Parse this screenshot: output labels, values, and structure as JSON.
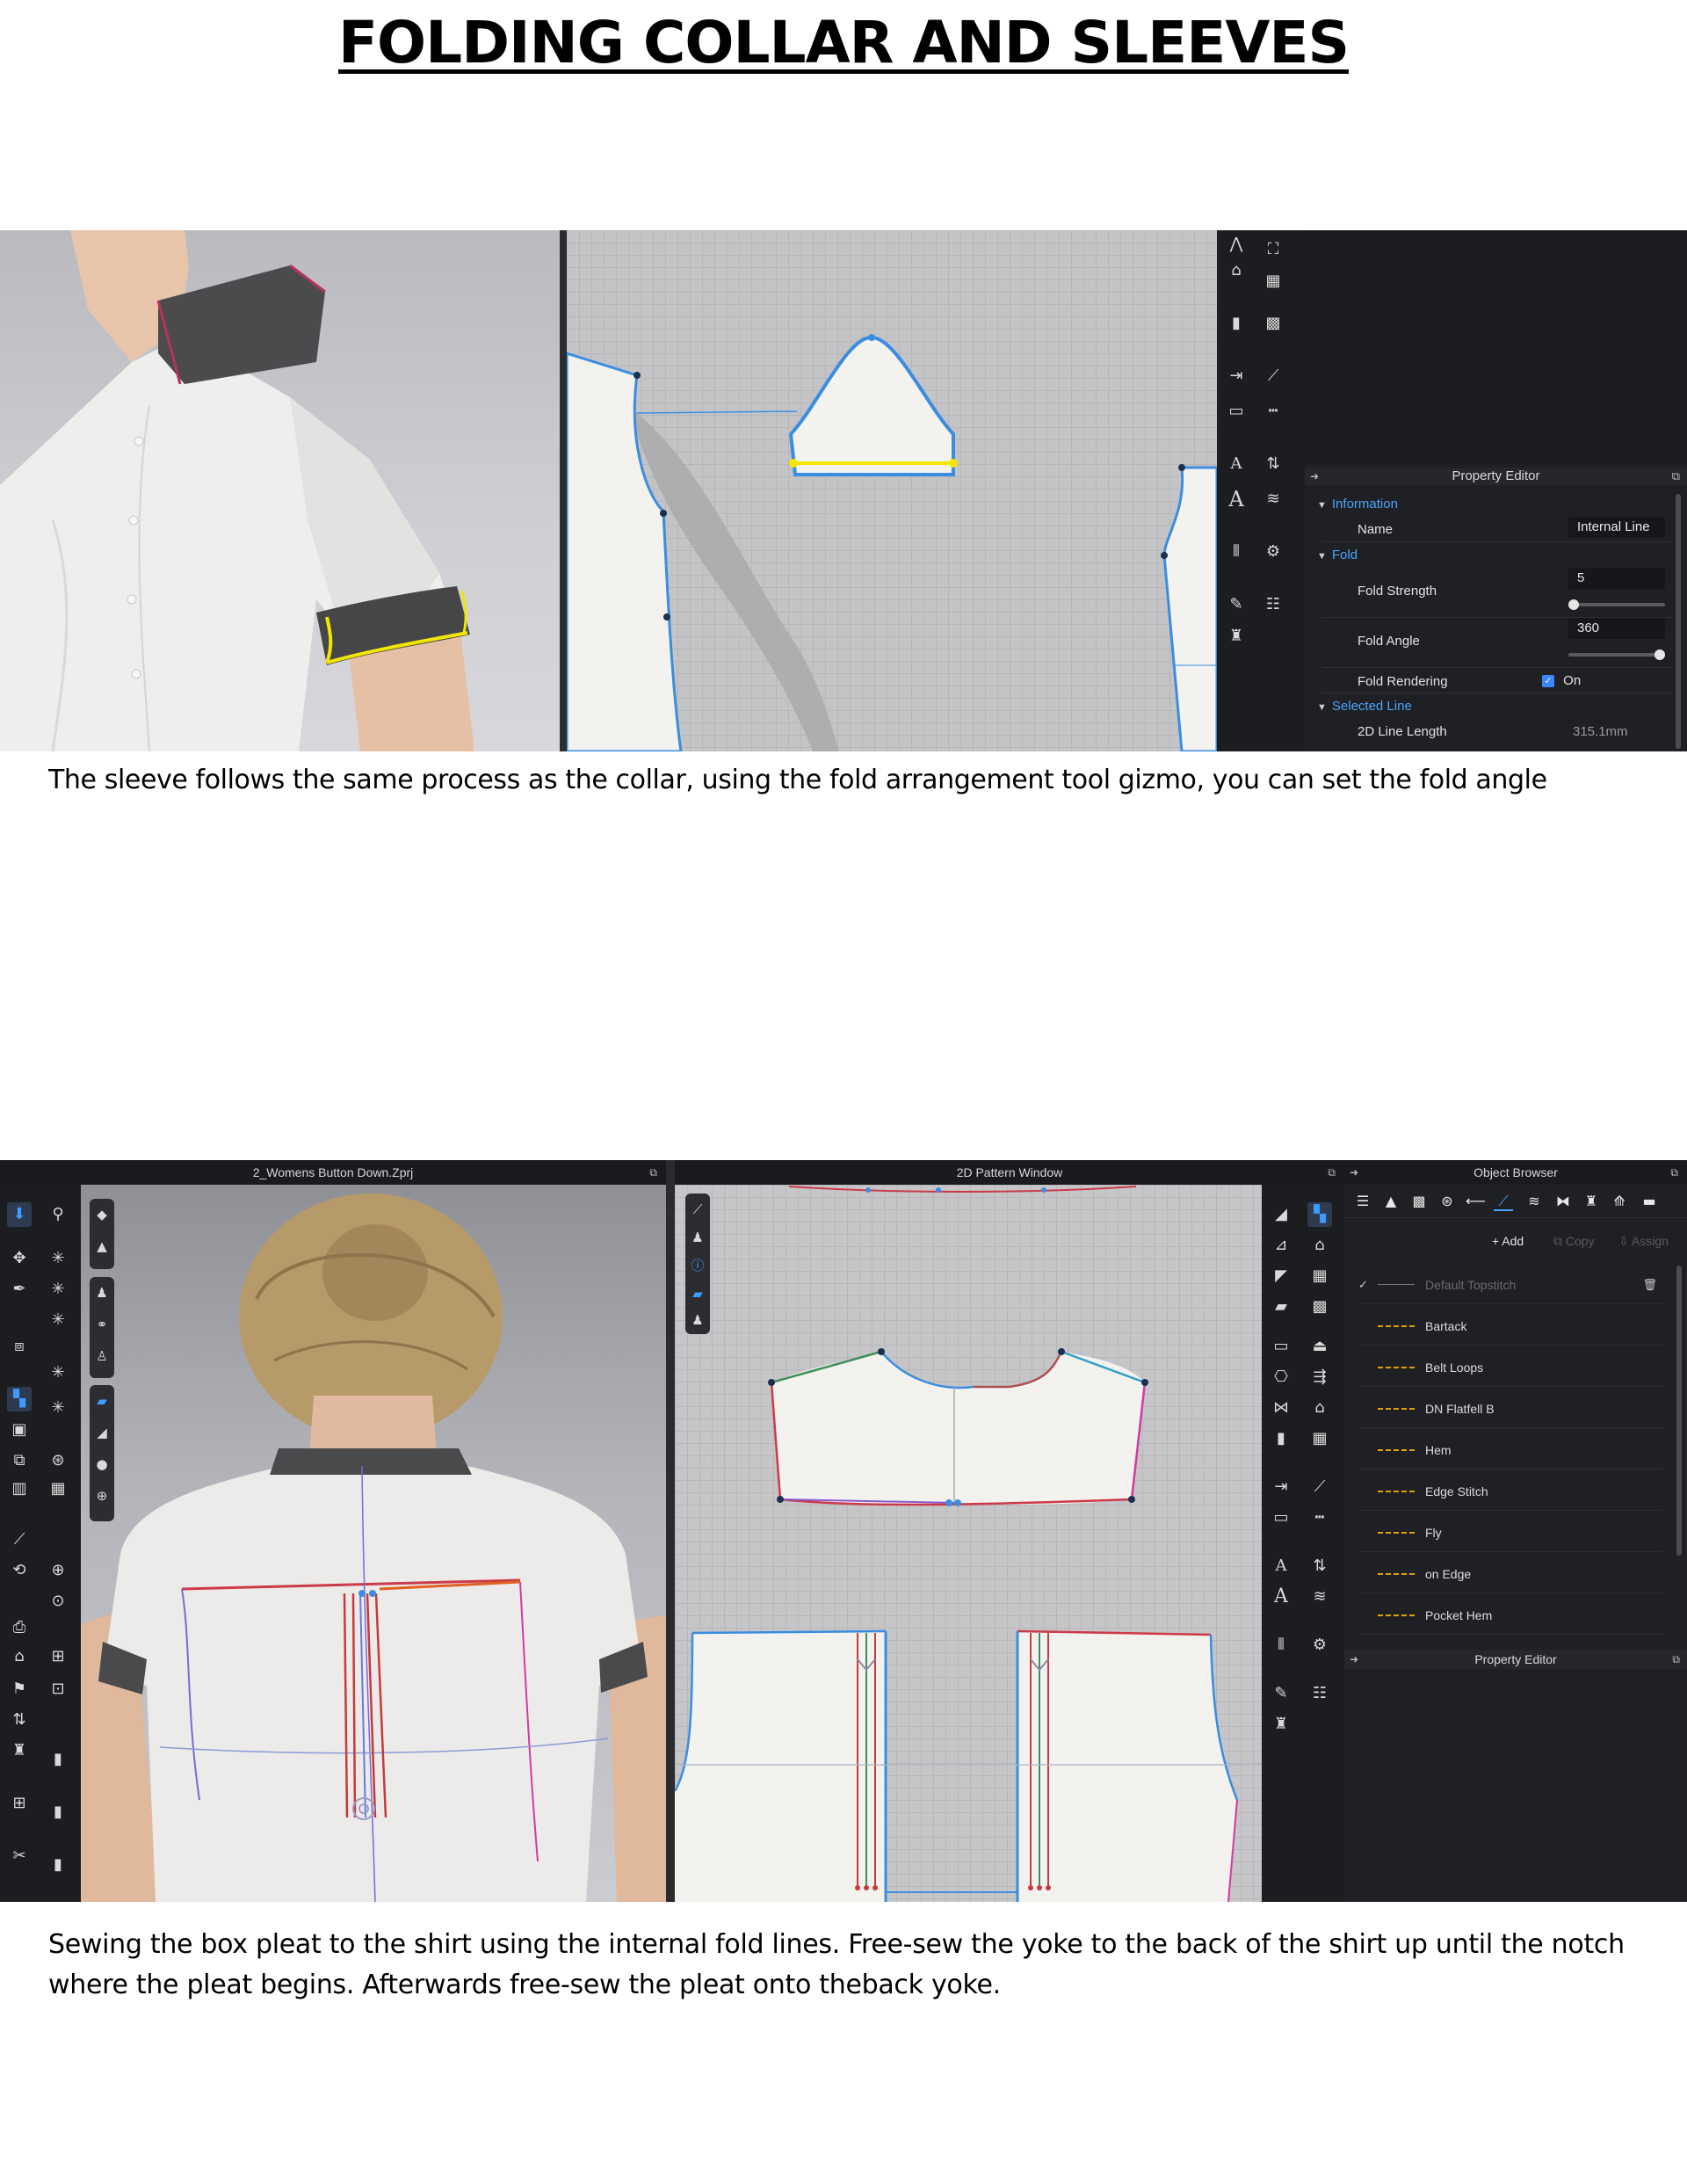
{
  "document": {
    "title": "FOLDING COLLAR AND SLEEVES",
    "caption_1": "The sleeve follows the same process as the collar, using the fold arrangement tool gizmo, you can set the fold angle",
    "caption_2": "Sewing the box pleat to the shirt using the internal fold lines. Free-sew the yoke to the back of the shirt up until the notch where the pleat begins. Afterwards free-sew the pleat onto theback yoke."
  },
  "screenshot_1": {
    "property_editor": {
      "title": "Property Editor",
      "information": {
        "section_label": "Information",
        "name_label": "Name",
        "name_value": "Internal Line"
      },
      "fold": {
        "section_label": "Fold",
        "strength_label": "Fold Strength",
        "strength_value": "5",
        "strength_fraction": 0.05,
        "angle_label": "Fold Angle",
        "angle_value": "360",
        "angle_fraction": 1.0,
        "rendering_label": "Fold Rendering",
        "rendering_value": "On"
      },
      "selected_line": {
        "section_label": "Selected Line",
        "length_label": "2D Line Length",
        "length_value": "315.1mm"
      }
    }
  },
  "screenshot_2": {
    "viewport_3d_title": "2_Womens Button Down.Zprj",
    "pattern_window_title": "2D Pattern Window",
    "object_browser": {
      "title": "Object Browser",
      "add_label": "+ Add",
      "copy_label": "Copy",
      "assign_label": "Assign",
      "items": [
        {
          "name": "Default Topstitch"
        },
        {
          "name": "Bartack"
        },
        {
          "name": "Belt Loops"
        },
        {
          "name": "DN Flatfell B"
        },
        {
          "name": "Hem"
        },
        {
          "name": "Edge Stitch"
        },
        {
          "name": "Fly"
        },
        {
          "name": "on Edge"
        },
        {
          "name": "Pocket Hem"
        }
      ]
    },
    "property_editor_title": "Property Editor"
  },
  "colors": {
    "accent_blue": "#4aa3ff",
    "fold_line_yellow": "#f5e600",
    "pattern_outline_blue": "#3a8de0",
    "app_dark": "#1f2023"
  }
}
